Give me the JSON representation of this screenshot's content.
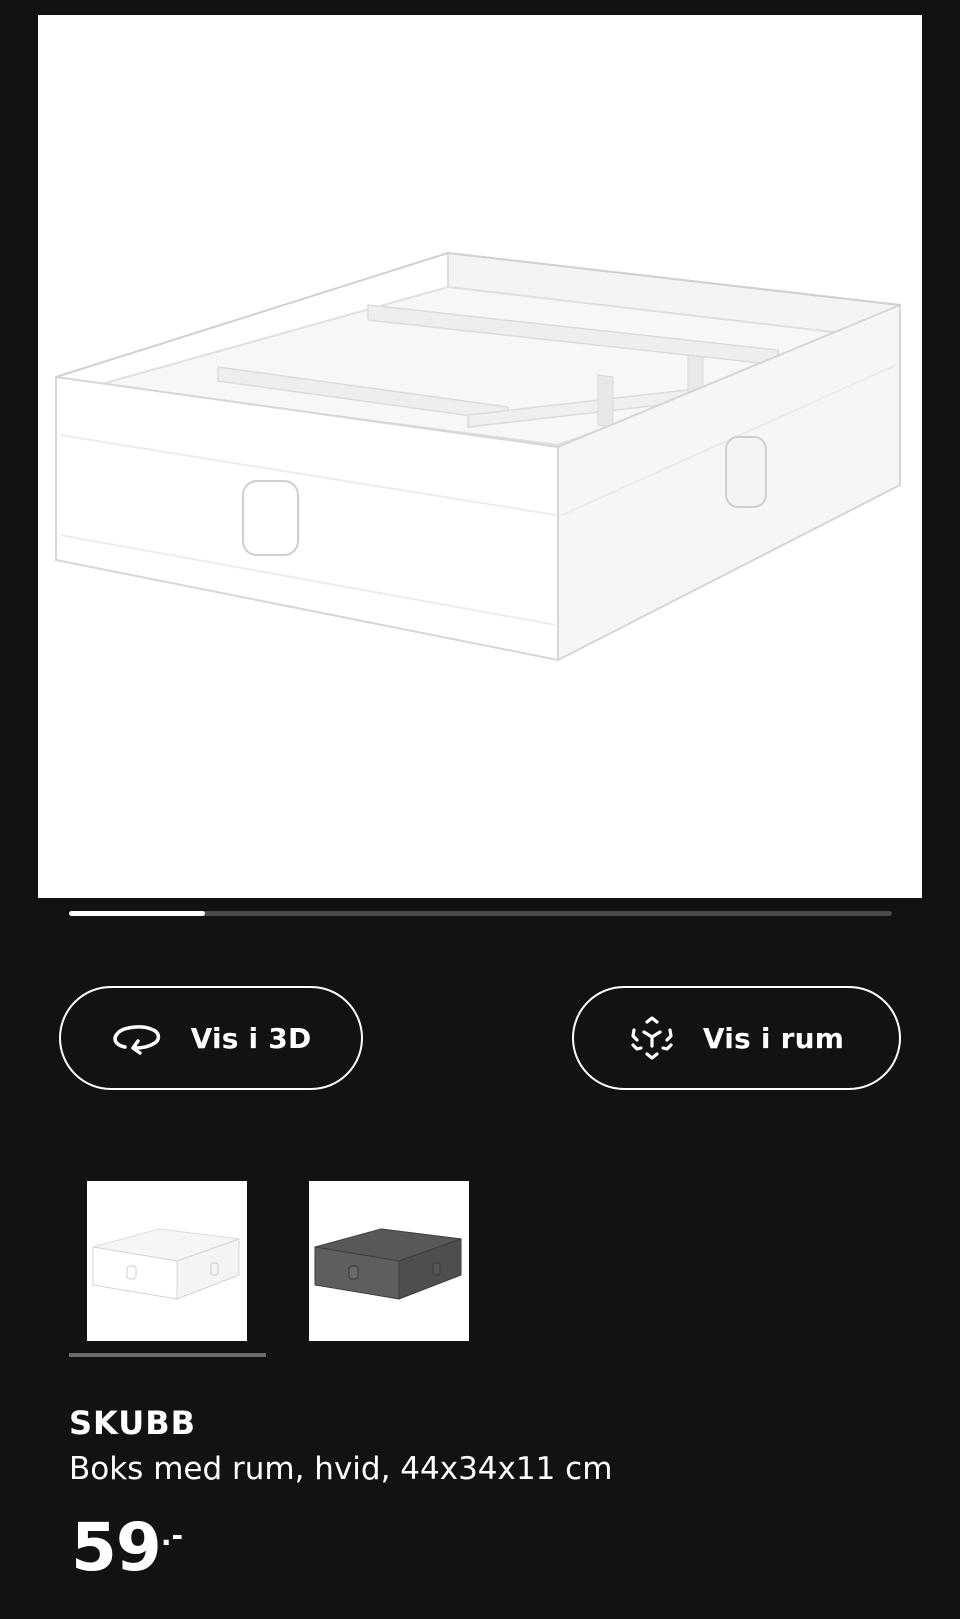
{
  "gallery": {
    "main_image_alt": "SKUBB",
    "progress_fraction": 0.165
  },
  "actions": {
    "view_3d_label": "Vis i 3D",
    "view_room_label": "Vis i rum"
  },
  "icons": {
    "view_3d": "rotate-3d-icon",
    "view_room": "ar-cube-icon"
  },
  "variants": [
    {
      "color_name": "hvid",
      "swatch": "#ffffff",
      "selected": true
    },
    {
      "color_name": "mørkegrå",
      "swatch": "#5a5a5a",
      "selected": false
    }
  ],
  "product": {
    "name": "SKUBB",
    "description": "Boks med rum, hvid, 44x34x11 cm",
    "price": "59",
    "price_suffix": ".-"
  },
  "colors": {
    "background": "#121212",
    "foreground": "#ffffff",
    "track": "#4a4a4a"
  }
}
